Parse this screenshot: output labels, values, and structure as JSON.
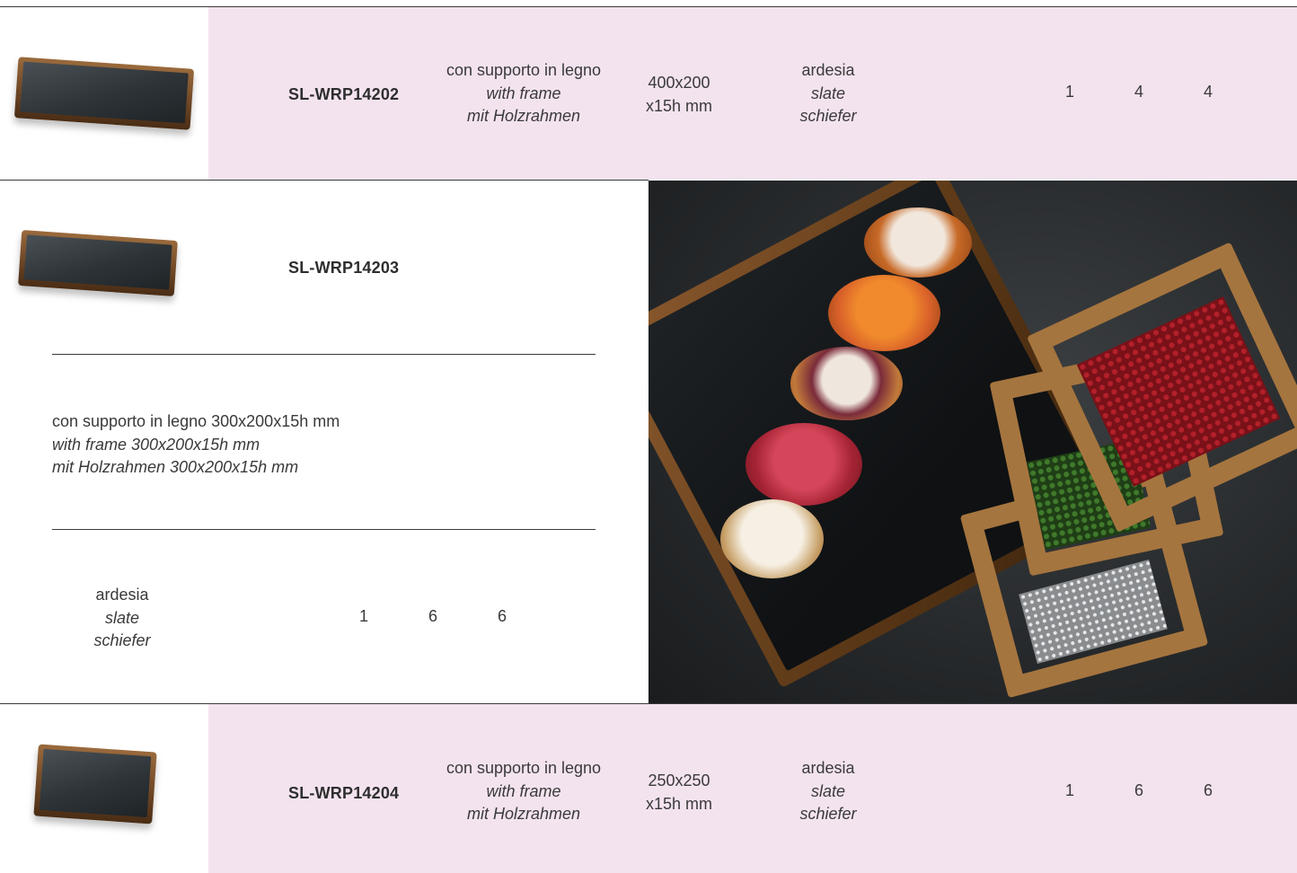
{
  "products": [
    {
      "code": "SL-WRP14202",
      "frame": {
        "it": "con supporto in legno",
        "en": "with frame",
        "de": "mit Holzrahmen"
      },
      "size": [
        "400x200",
        "x15h mm"
      ],
      "material": {
        "it": "ardesia",
        "en": "slate",
        "de": "schiefer"
      },
      "qty": [
        "1",
        "4",
        "4"
      ]
    },
    {
      "code": "SL-WRP14203",
      "frame": {
        "it": "con supporto in legno 300x200x15h mm",
        "en": "with frame 300x200x15h mm",
        "de": "mit Holzrahmen 300x200x15h mm"
      },
      "material": {
        "it": "ardesia",
        "en": "slate",
        "de": "schiefer"
      },
      "qty": [
        "1",
        "6",
        "6"
      ]
    },
    {
      "code": "SL-WRP14204",
      "frame": {
        "it": "con supporto in legno",
        "en": "with frame",
        "de": "mit Holzrahmen"
      },
      "size": [
        "250x250",
        "x15h mm"
      ],
      "material": {
        "it": "ardesia",
        "en": "slate",
        "de": "schiefer"
      },
      "qty": [
        "1",
        "6",
        "6"
      ]
    }
  ],
  "colors": {
    "row_band": "#f3e3ef",
    "rule": "#3a3a3a",
    "text": "#3a3a3a"
  }
}
